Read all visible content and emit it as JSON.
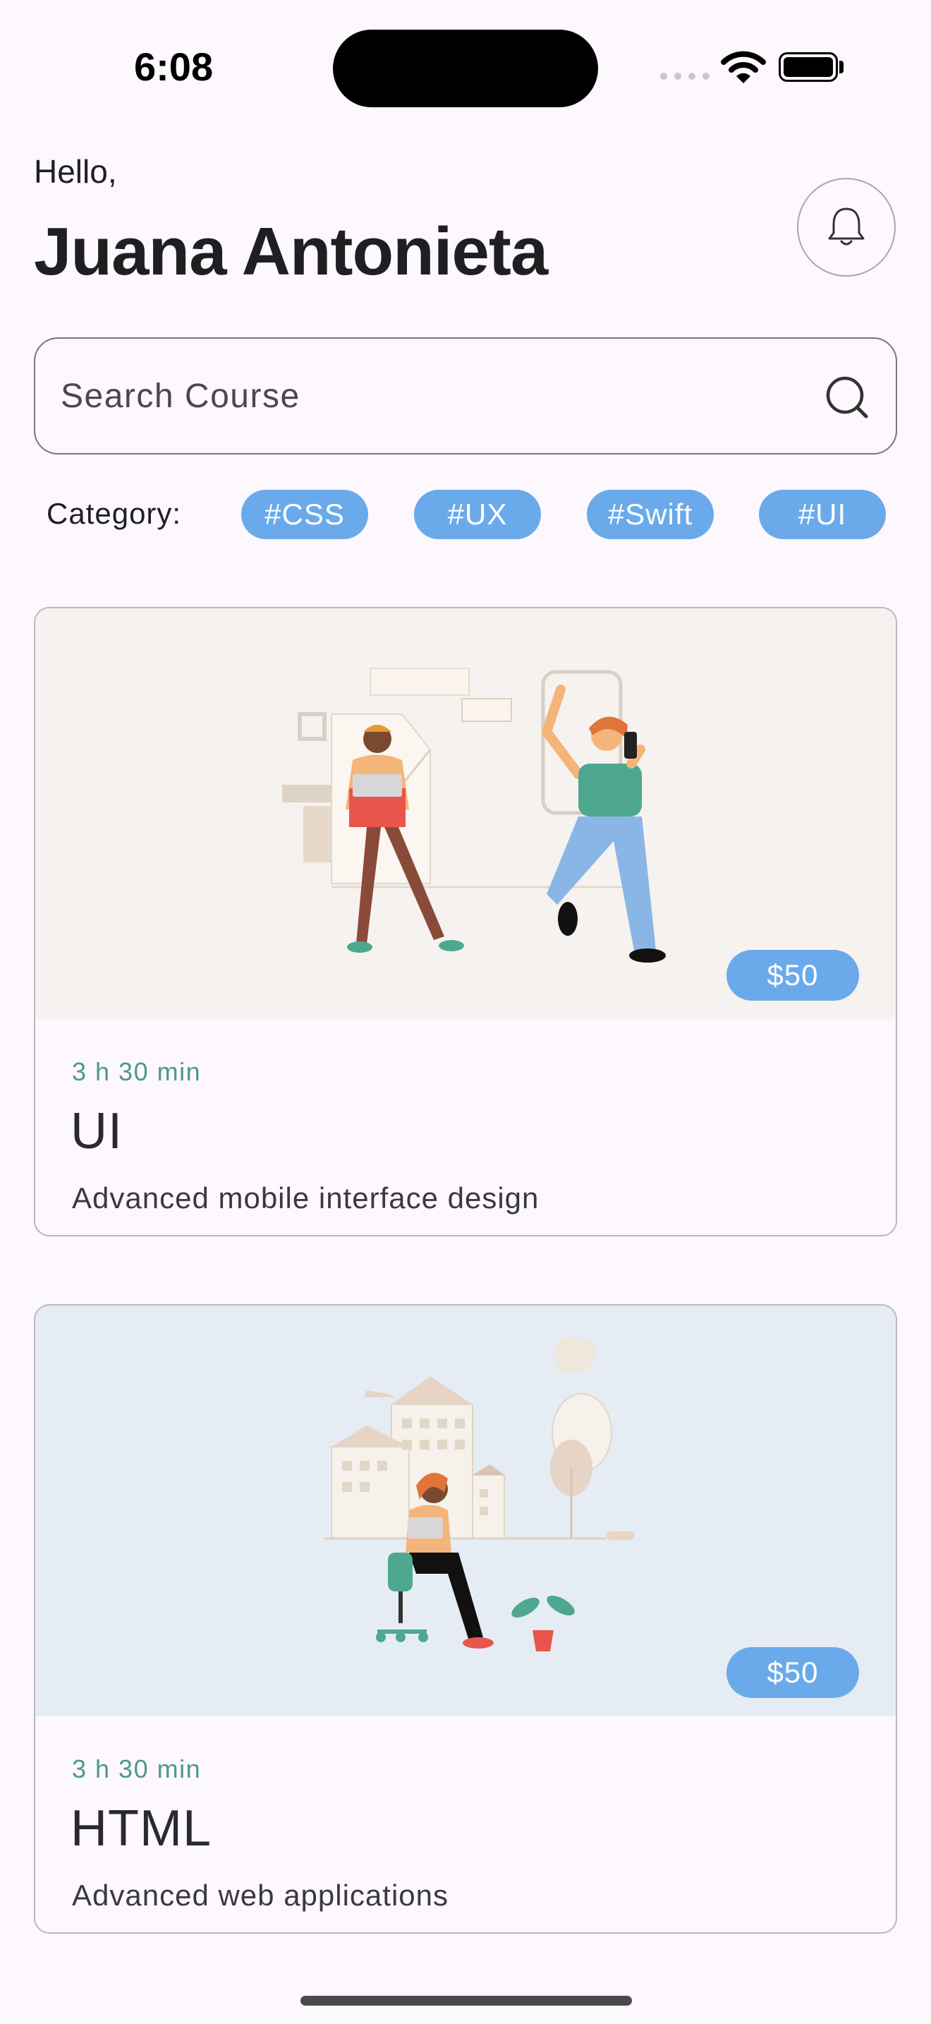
{
  "status_bar": {
    "time": "6:08"
  },
  "greeting": {
    "hello": "Hello,",
    "name": "Juana Antonieta"
  },
  "header": {
    "notification_icon": "bell-icon"
  },
  "search": {
    "placeholder": "Search Course",
    "icon": "search-icon"
  },
  "category": {
    "label": "Category:",
    "chips": [
      "#CSS",
      "#UX",
      "#Swift",
      "#UI"
    ]
  },
  "courses": [
    {
      "price": "$50",
      "duration": "3 h 30 min",
      "title": "UI",
      "description": "Advanced mobile interface design",
      "image_bg": "#f6f2ef"
    },
    {
      "price": "$50",
      "duration": "3 h 30 min",
      "title": "HTML",
      "description": "Advanced web applications",
      "image_bg": "#e6ecf4"
    }
  ],
  "colors": {
    "accent": "#6aaaea",
    "duration": "#4e9a84",
    "background": "#fdf7fe"
  }
}
